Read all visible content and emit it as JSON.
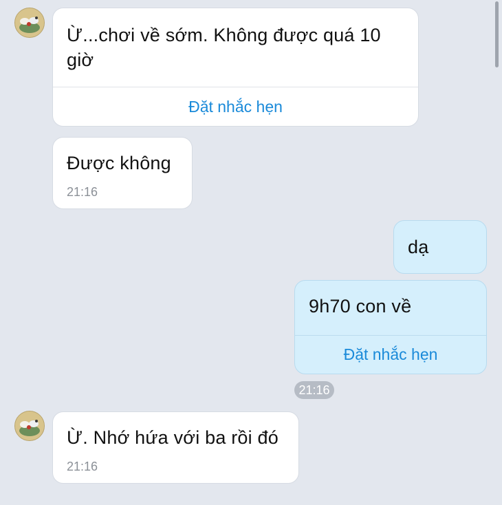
{
  "colors": {
    "background": "#e3e7ee",
    "incoming_bubble": "#ffffff",
    "outgoing_bubble": "#d5effc",
    "action_link": "#1a8ad9",
    "time_text": "#8b9097"
  },
  "icons": {
    "avatar": "contact-avatar-icon"
  },
  "messages": [
    {
      "direction": "incoming",
      "text_line1": "Ừ...chơi về sớm.  Không được quá 10",
      "text_line2": "giờ",
      "action": "Đặt nhắc hẹn"
    },
    {
      "direction": "incoming",
      "text": "Được không",
      "time": "21:16"
    },
    {
      "direction": "outgoing",
      "text": "dạ"
    },
    {
      "direction": "outgoing",
      "text": "9h70 con về",
      "action": "Đặt nhắc hẹn",
      "time": "21:16"
    },
    {
      "direction": "incoming",
      "text": "Ừ. Nhớ hứa với ba rồi đó",
      "time": "21:16"
    }
  ]
}
